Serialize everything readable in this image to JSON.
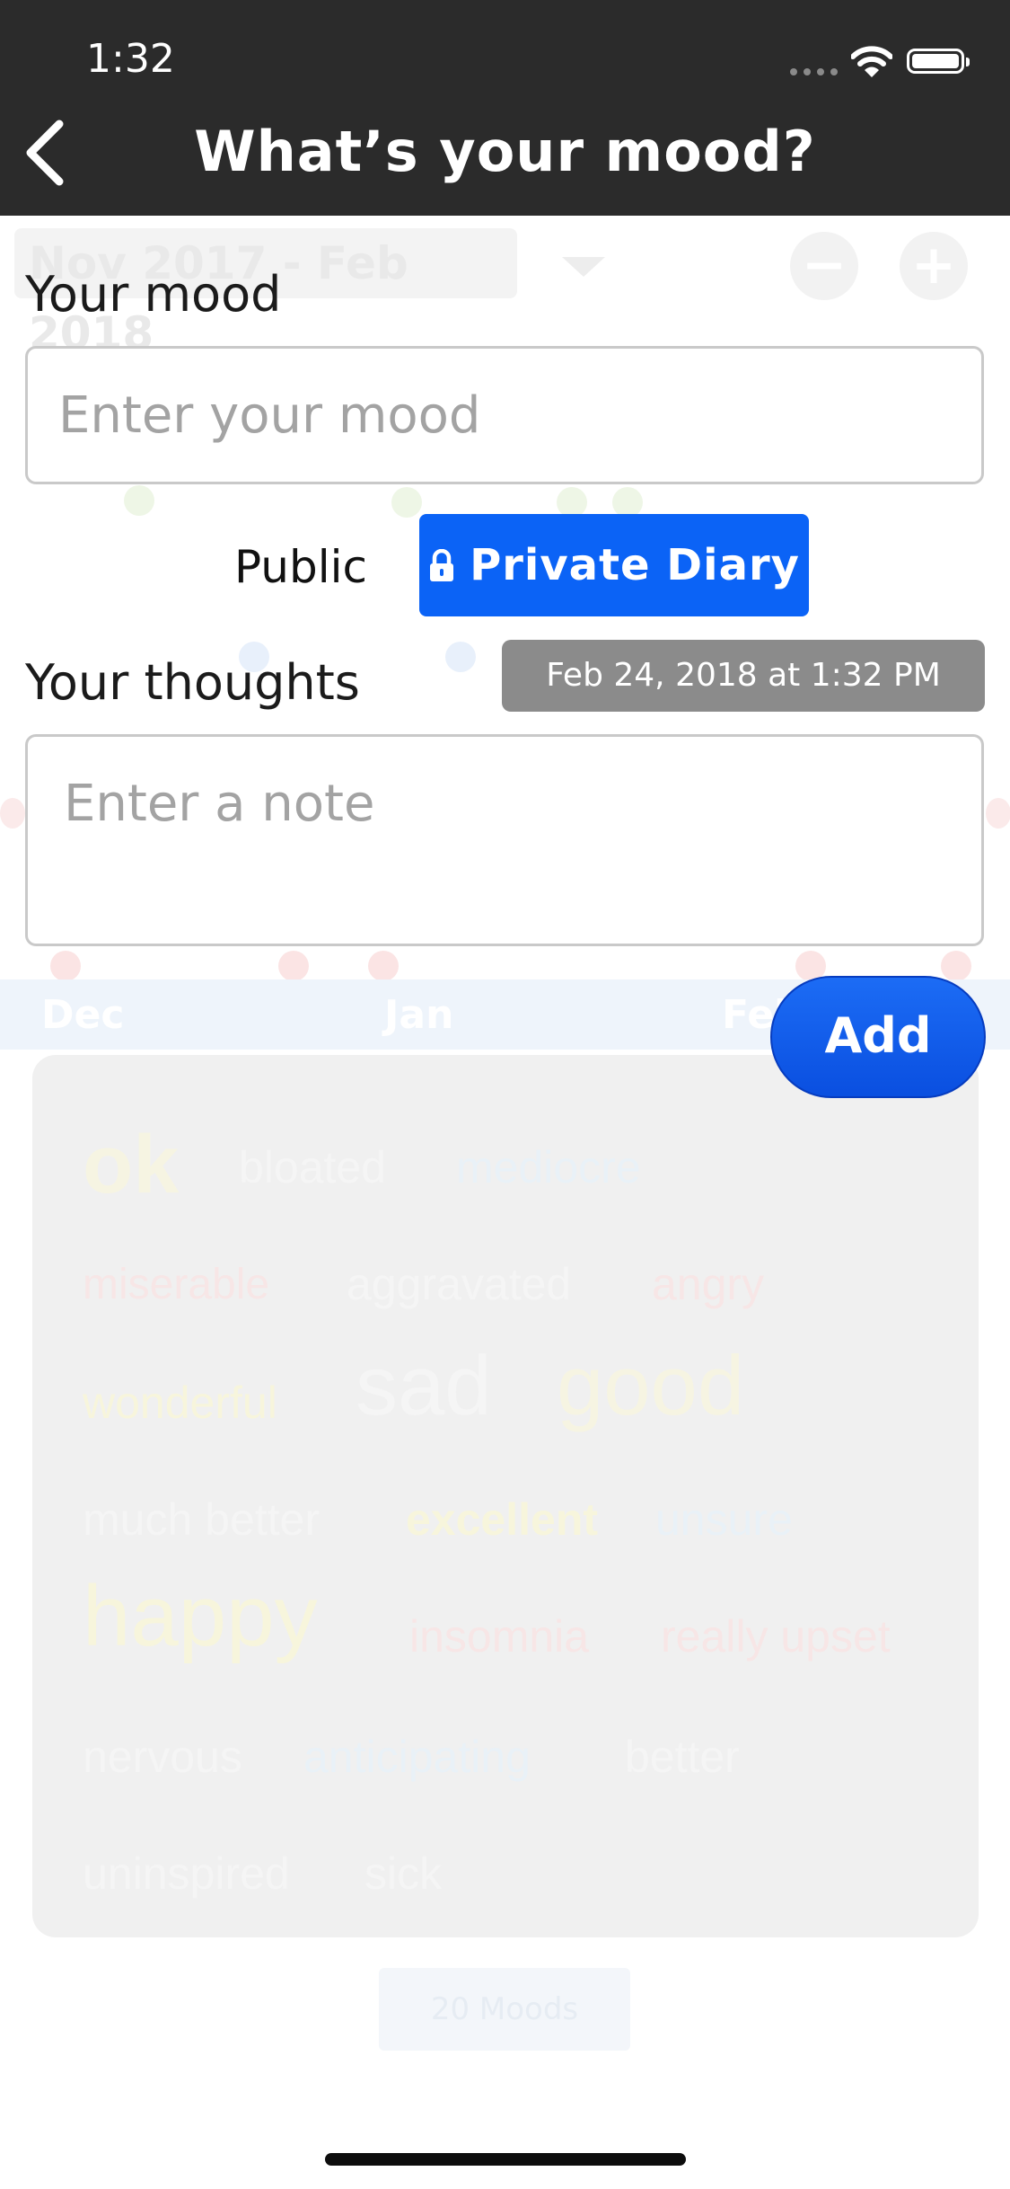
{
  "status_bar": {
    "time": "1:32"
  },
  "nav": {
    "title": "What’s your mood?"
  },
  "background": {
    "date_range": "Nov 2017 - Feb 2018",
    "months": [
      "Dec",
      "Jan",
      "Feb"
    ],
    "mood_count": "20 Moods",
    "word_cloud": [
      "ok",
      "bloated",
      "mediocre",
      "miserable",
      "aggravated",
      "angry",
      "wonderful",
      "sad",
      "good",
      "much better",
      "excellent",
      "unsure",
      "happy",
      "insomnia",
      "really upset",
      "nervous",
      "anticipating",
      "better",
      "uninspired",
      "sick"
    ]
  },
  "form": {
    "mood_label": "Your mood",
    "mood_placeholder": "Enter your mood",
    "mood_value": "",
    "visibility": {
      "public_label": "Public",
      "private_label": "Private Diary",
      "selected": "Private Diary"
    },
    "thoughts_label": "Your thoughts",
    "date_label": "Feb 24, 2018 at 1:32 PM",
    "note_placeholder": "Enter a note",
    "note_value": "",
    "add_label": "Add"
  },
  "colors": {
    "accent": "#0b63f6",
    "nav_bg": "#2b2b2b",
    "date_chip": "#8b8b8b"
  },
  "icons": {
    "back": "chevron-left-icon",
    "lock": "lock-icon",
    "wifi": "wifi-icon",
    "battery": "battery-icon"
  }
}
